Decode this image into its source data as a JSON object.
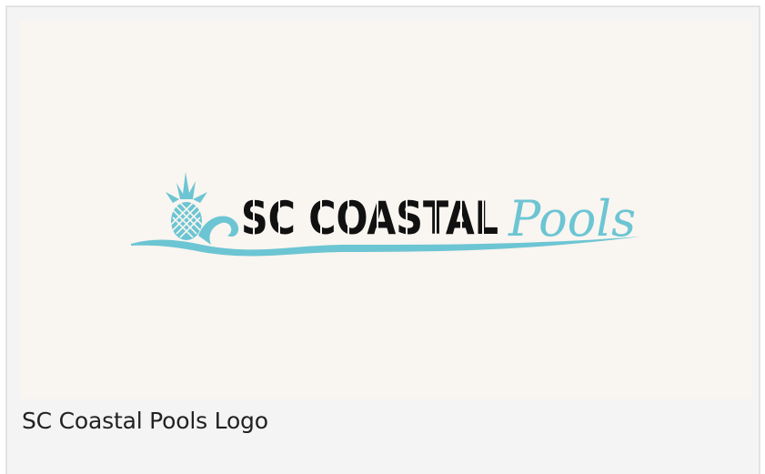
{
  "logo": {
    "brand_word_1": "SC COASTAL",
    "brand_word_2": "Pools",
    "icon": "pineapple-wave-icon",
    "colors": {
      "dark": "#111111",
      "teal": "#6cc5d3",
      "background": "#f9f5f0"
    }
  },
  "caption": {
    "text": "SC Coastal Pools Logo"
  },
  "colors": {
    "card_background": "#f4f4f4",
    "card_border": "#e3e3e3",
    "caption_text": "#222222"
  }
}
